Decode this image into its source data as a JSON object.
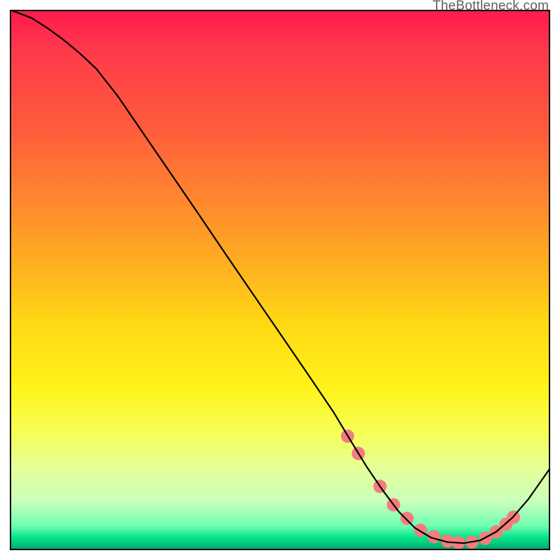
{
  "watermark": "TheBottleneck.com",
  "chart_data": {
    "type": "line",
    "title": "",
    "xlabel": "",
    "ylabel": "",
    "xlim": [
      0,
      100
    ],
    "ylim": [
      0,
      100
    ],
    "grid": false,
    "legend": false,
    "series": [
      {
        "name": "curve",
        "x": [
          0,
          4,
          7,
          10,
          13,
          16,
          20,
          25,
          30,
          35,
          40,
          45,
          50,
          55,
          60,
          63,
          66,
          69,
          72,
          75,
          78,
          81,
          84,
          87,
          90,
          93,
          96,
          100
        ],
        "y": [
          100,
          98.5,
          96.6,
          94.4,
          91.9,
          89.1,
          84.0,
          76.7,
          69.4,
          62.1,
          54.7,
          47.4,
          40.1,
          32.8,
          25.4,
          20.4,
          15.5,
          11.1,
          7.1,
          4.1,
          2.3,
          1.5,
          1.3,
          1.8,
          3.4,
          6.0,
          9.5,
          15.2
        ]
      }
    ],
    "markers": {
      "name": "dots",
      "x": [
        62.5,
        64.5,
        68.5,
        71.0,
        73.5,
        76.0,
        78.5,
        81.0,
        83.0,
        85.5,
        88.0,
        90.0,
        91.8,
        93.2
      ],
      "y": [
        21.1,
        17.9,
        11.8,
        8.4,
        5.9,
        3.7,
        2.5,
        1.7,
        1.4,
        1.5,
        2.2,
        3.4,
        4.8,
        6.1
      ],
      "radius": 9.5,
      "color": "#f37d7d"
    },
    "colors": {
      "gradient_top": "#ff1a4d",
      "gradient_mid": "#fff31a",
      "gradient_bottom": "#00a068",
      "curve": "#000000",
      "marker": "#f37d7d",
      "watermark": "#5f5f5f"
    }
  }
}
